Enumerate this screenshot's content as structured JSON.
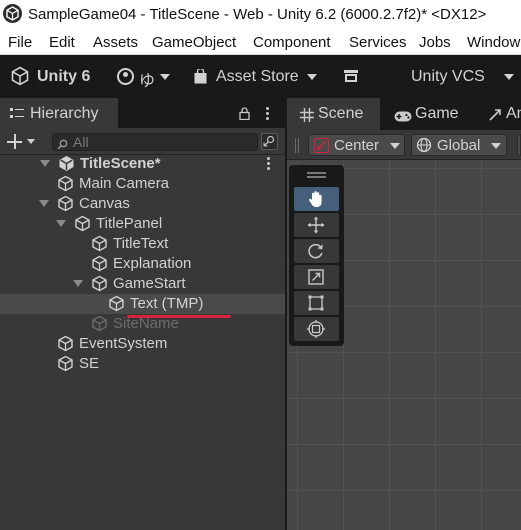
{
  "window": {
    "title": "SampleGame04 - TitleScene - Web - Unity 6.2 (6000.2.7f2)* <DX12>"
  },
  "menu": {
    "items": [
      "File",
      "Edit",
      "Assets",
      "GameObject",
      "Component",
      "Services",
      "Jobs",
      "Window"
    ]
  },
  "toolbar": {
    "unity_label": "Unity 6",
    "account_label": "ゆ",
    "asset_store_label": "Asset Store",
    "vcs_label": "Unity VCS"
  },
  "hierarchy": {
    "tab_label": "Hierarchy",
    "search_placeholder": "All",
    "scene_name": "TitleScene*",
    "nodes": [
      {
        "label": "Main Camera",
        "depth": 1,
        "expanded": null,
        "selected": false,
        "disabled": false
      },
      {
        "label": "Canvas",
        "depth": 1,
        "expanded": true,
        "selected": false,
        "disabled": false
      },
      {
        "label": "TitlePanel",
        "depth": 2,
        "expanded": true,
        "selected": false,
        "disabled": false
      },
      {
        "label": "TitleText",
        "depth": 3,
        "expanded": null,
        "selected": false,
        "disabled": false
      },
      {
        "label": "Explanation",
        "depth": 3,
        "expanded": null,
        "selected": false,
        "disabled": false
      },
      {
        "label": "GameStart",
        "depth": 3,
        "expanded": true,
        "selected": false,
        "disabled": false
      },
      {
        "label": "Text (TMP)",
        "depth": 4,
        "expanded": null,
        "selected": true,
        "disabled": false
      },
      {
        "label": "SiteName",
        "depth": 3,
        "expanded": null,
        "selected": false,
        "disabled": true
      },
      {
        "label": "EventSystem",
        "depth": 1,
        "expanded": null,
        "selected": false,
        "disabled": false
      },
      {
        "label": "SE",
        "depth": 1,
        "expanded": null,
        "selected": false,
        "disabled": false
      }
    ]
  },
  "scene": {
    "tabs": [
      "Scene",
      "Game",
      "An"
    ],
    "pivot_mode": "Center",
    "pivot_rotation": "Global",
    "tools": [
      "hand-tool",
      "move-tool",
      "rotate-tool",
      "scale-tool",
      "rect-tool",
      "transform-tool"
    ],
    "active_tool": "hand-tool"
  },
  "colors": {
    "selection": "#4a4a4a",
    "annotation_underline": "#d8223d",
    "active_tool": "#46607c"
  }
}
